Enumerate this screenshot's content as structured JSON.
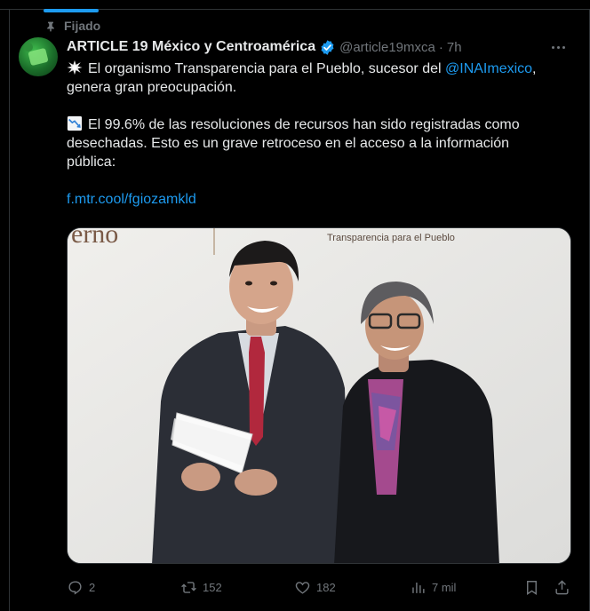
{
  "pinned_label": "Fijado",
  "author": {
    "name": "ARTICLE 19 México y Centroamérica",
    "handle": "@article19mxca",
    "separator": "·",
    "time": "7h"
  },
  "tweet": {
    "line1_prefix": "El organismo Transparencia para el Pueblo, sucesor del ",
    "line1_mention": "@INAImexico",
    "line1_suffix": ",",
    "line2": "genera gran preocupación.",
    "line3": "El 99.6% de las resoluciones de recursos han sido registradas como",
    "line4": "desechadas. Esto es un grave retroceso en el acceso a la información",
    "line5": "pública:",
    "link": "f.mtr.cool/fgiozamkld"
  },
  "media": {
    "banner_left": "erno",
    "banner_right": "Transparencia para el Pueblo"
  },
  "actions": {
    "replies": "2",
    "reposts": "152",
    "likes": "182",
    "views": "7 mil"
  },
  "icons": {
    "pin": "pin-icon",
    "verified": "verified-badge-icon",
    "more": "more-icon",
    "emoji1": "collision-emoji-icon",
    "emoji2": "chart-decreasing-emoji-icon",
    "reply": "reply-icon",
    "repost": "repost-icon",
    "like": "like-icon",
    "views": "views-icon",
    "bookmark": "bookmark-icon",
    "share": "share-icon"
  },
  "colors": {
    "accent": "#1d9bf0",
    "muted": "#71767b",
    "text": "#e7e9ea",
    "background": "#000000"
  }
}
